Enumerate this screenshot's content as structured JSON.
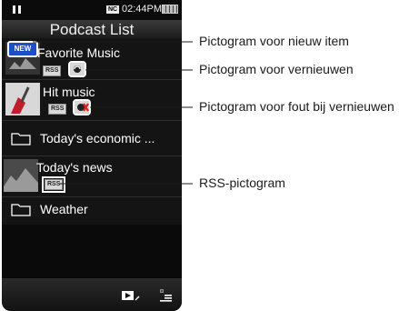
{
  "device": {
    "status": {
      "time": "02:44PM",
      "nc_label": "NC"
    },
    "header": {
      "title": "Podcast List"
    },
    "items": [
      {
        "title": "Favorite Music",
        "rss": "RSS",
        "new_badge": "NEW"
      },
      {
        "title": "Hit music",
        "rss": "RSS"
      },
      {
        "title": "Today's economic ..."
      },
      {
        "title": "Today's news",
        "rss": "RSS"
      },
      {
        "title": "Weather"
      }
    ]
  },
  "callouts": [
    {
      "label": "Pictogram voor nieuw item"
    },
    {
      "label": "Pictogram voor vernieuwen"
    },
    {
      "label": "Pictogram voor fout bij vernieuwen"
    },
    {
      "label": "RSS-pictogram"
    }
  ],
  "colors": {
    "screen": "#0a0a0a",
    "new_badge": "#1f4fc4",
    "highlight_box": "#ffffff",
    "error_x": "#e0201a"
  }
}
